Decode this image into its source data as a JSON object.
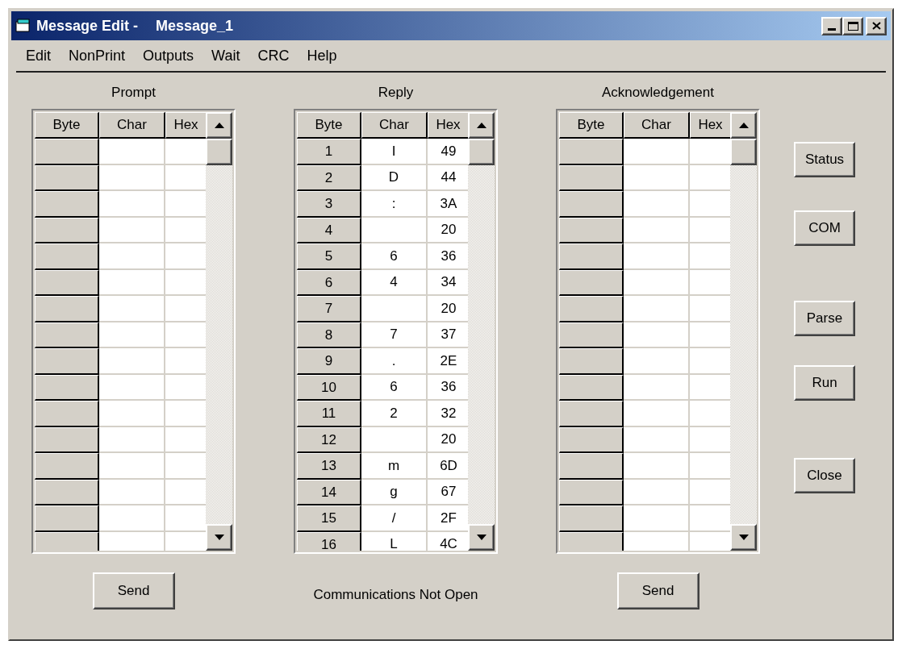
{
  "window": {
    "title": "Message Edit -",
    "document": "Message_1"
  },
  "menu": [
    "Edit",
    "NonPrint",
    "Outputs",
    "Wait",
    "CRC",
    "Help"
  ],
  "tables": [
    {
      "label": "Prompt",
      "columns": [
        "Byte",
        "Char",
        "Hex"
      ],
      "send_button": "Send"
    },
    {
      "label": "Reply",
      "columns": [
        "Byte",
        "Char",
        "Hex"
      ],
      "rows": [
        {
          "byte": "1",
          "char": "I",
          "hex": "49"
        },
        {
          "byte": "2",
          "char": "D",
          "hex": "44"
        },
        {
          "byte": "3",
          "char": ":",
          "hex": "3A"
        },
        {
          "byte": "4",
          "hex": "20"
        },
        {
          "byte": "5",
          "char": "6",
          "hex": "36"
        },
        {
          "byte": "6",
          "char": "4",
          "hex": "34"
        },
        {
          "byte": "7",
          "hex": "20"
        },
        {
          "byte": "8",
          "char": "7",
          "hex": "37"
        },
        {
          "byte": "9",
          "char": ".",
          "hex": "2E"
        },
        {
          "byte": "10",
          "char": "6",
          "hex": "36"
        },
        {
          "byte": "11",
          "char": "2",
          "hex": "32"
        },
        {
          "byte": "12",
          "hex": "20"
        },
        {
          "byte": "13",
          "char": "m",
          "hex": "6D"
        },
        {
          "byte": "14",
          "char": "g",
          "hex": "67"
        },
        {
          "byte": "15",
          "char": "/",
          "hex": "2F"
        },
        {
          "byte": "16",
          "char": "L",
          "hex": "4C"
        }
      ]
    },
    {
      "label": "Acknowledgement",
      "columns": [
        "Byte",
        "Char",
        "Hex"
      ],
      "send_button": "Send"
    }
  ],
  "status": "Communications Not Open",
  "side_buttons": [
    "Status",
    "COM",
    "Parse",
    "Run",
    "Close"
  ]
}
